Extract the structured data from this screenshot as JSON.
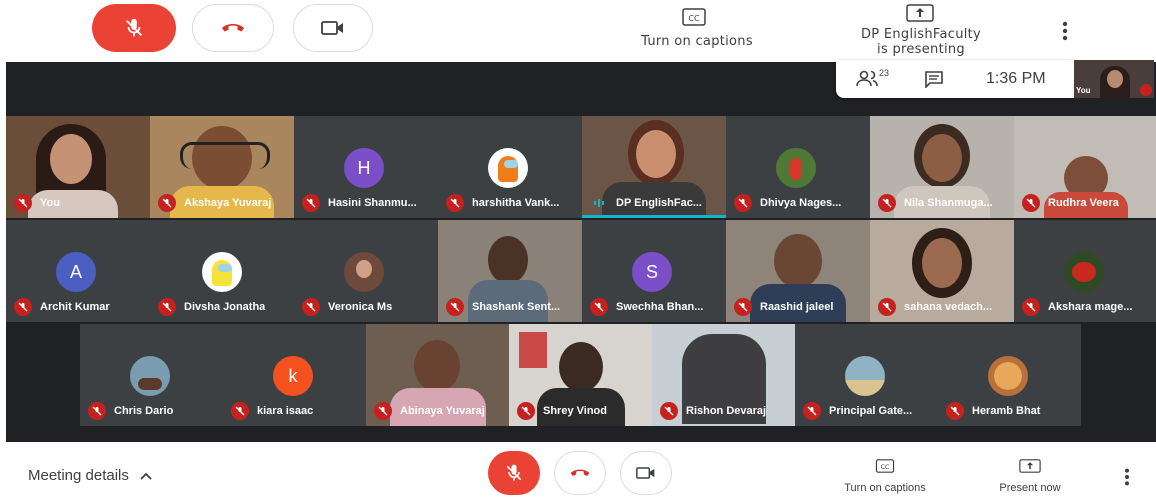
{
  "topbar": {
    "captions_label": "Turn on captions",
    "presenter_line1": "DP EnglishFaculty",
    "presenter_line2": "is presenting"
  },
  "info": {
    "participant_count": "23",
    "time": "1:36 PM",
    "self_label": "You"
  },
  "tiles": {
    "you": "You",
    "akshaya": "Akshaya Yuvaraj",
    "hasini": "Hasini Shanmu...",
    "harshitha": "harshitha Vank...",
    "dpenglish": "DP EnglishFac...",
    "dhivya": "Dhivya Nages...",
    "nila": "Nila Shanmuga...",
    "rudhra": "Rudhra Veera",
    "archit": "Archit Kumar",
    "divsha": "Divsha Jonatha",
    "veronica": "Veronica Ms",
    "shashank": "Shashank Sent...",
    "swechha": "Swechha Bhan...",
    "raashid": "Raashid jaleel",
    "sahana": "sahana vedach...",
    "akshara": "Akshara mage...",
    "chris": "Chris Dario",
    "kiara": "kiara isaac",
    "abinaya": "Abinaya Yuvaraj",
    "shrey": "Shrey Vinod",
    "rishon": "Rishon Devaraj",
    "principal": "Principal Gate...",
    "heramb": "Heramb Bhat"
  },
  "avatars": {
    "hasini": "H",
    "archit": "A",
    "swechha": "S",
    "kiara": "k"
  },
  "bottombar": {
    "meeting_details": "Meeting details",
    "captions_label": "Turn on captions",
    "present_label": "Present now"
  },
  "colors": {
    "danger": "#ea4335",
    "stage": "#202124",
    "avatar_purple": "#7b4fc7",
    "avatar_blue": "#4a5fc1",
    "avatar_orange": "#f4511e"
  }
}
